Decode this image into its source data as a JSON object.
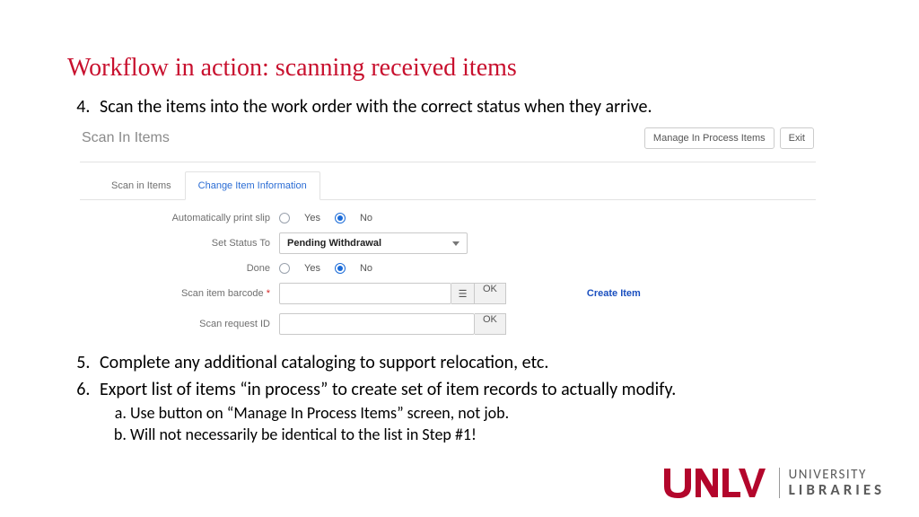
{
  "title": "Workflow in action: scanning received items",
  "steps": {
    "s4": "Scan the items into the work order with the correct status when they arrive.",
    "s5": "Complete any additional cataloging to support relocation, etc.",
    "s6": "Export list of items “in process” to create set of item records to actually modify.",
    "s6a": "Use button on “Manage In Process Items” screen, not job.",
    "s6b": "Will not necessarily be identical to the list in Step #1!"
  },
  "app": {
    "title": "Scan In Items",
    "btn_manage": "Manage In Process Items",
    "btn_exit": "Exit",
    "tabs": {
      "scan": "Scan in Items",
      "change": "Change Item Information"
    },
    "labels": {
      "auto_print": "Automatically print slip",
      "set_status": "Set Status To",
      "done": "Done",
      "barcode": "Scan item barcode",
      "request": "Scan request ID",
      "req_mark": "*"
    },
    "radios": {
      "yes": "Yes",
      "no": "No"
    },
    "status_value": "Pending Withdrawal",
    "ok": "OK",
    "list_icon": "☰",
    "create_item": "Create Item"
  },
  "logo": {
    "uni": "UNIVERSITY",
    "lib": "LIBRARIES"
  }
}
